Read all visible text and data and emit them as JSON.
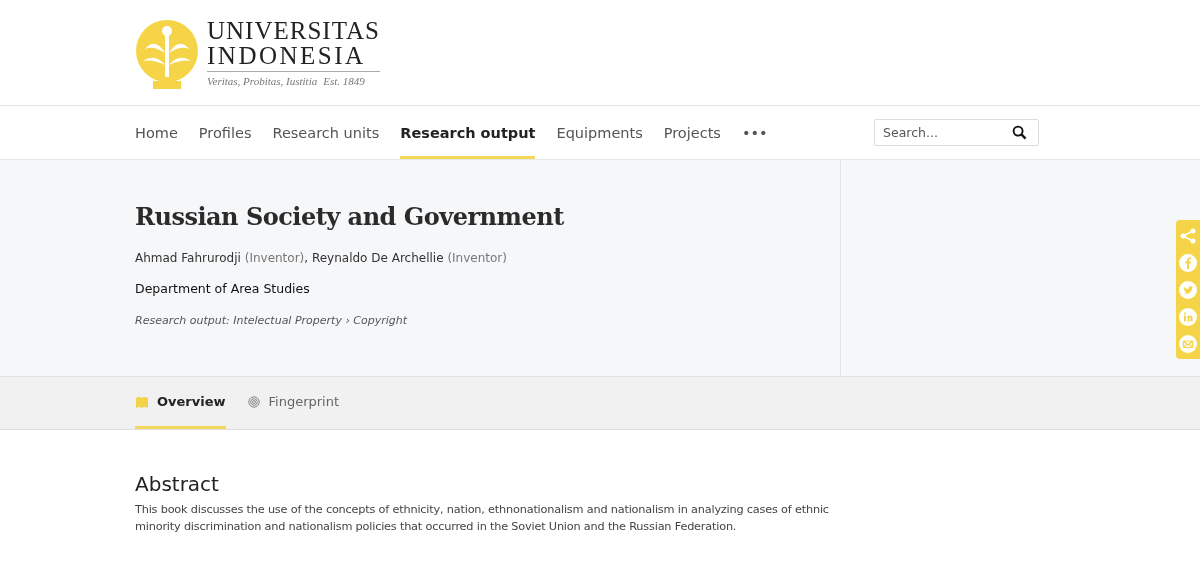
{
  "logo": {
    "name_line1": "UNIVERSITAS",
    "name_line2": "INDONESIA",
    "motto": "Veritas, Probitas, Iustitia",
    "established": "Est. 1849"
  },
  "nav": [
    {
      "label": "Home",
      "selected": false
    },
    {
      "label": "Profiles",
      "selected": false
    },
    {
      "label": "Research units",
      "selected": false
    },
    {
      "label": "Research output",
      "selected": true
    },
    {
      "label": "Equipments",
      "selected": false
    },
    {
      "label": "Projects",
      "selected": false
    },
    {
      "label": "•••",
      "selected": false
    }
  ],
  "search": {
    "placeholder": "Search..."
  },
  "title": "Russian Society and Government",
  "authors": [
    {
      "name": "Ahmad Fahrurodji",
      "role": "(Inventor)",
      "separator": ","
    },
    {
      "name": "Reynaldo De Archellie",
      "role": "(Inventor)"
    }
  ],
  "department": "Department of Area Studies",
  "type_line": "Research output: Intelectual Property › Copyright",
  "share": [
    {
      "kind": "share"
    },
    {
      "kind": "facebook"
    },
    {
      "kind": "twitter"
    },
    {
      "kind": "linkedin"
    },
    {
      "kind": "email"
    }
  ],
  "tabs": [
    {
      "label": "Overview",
      "kind": "book",
      "selected": true
    },
    {
      "label": "Fingerprint",
      "kind": "fingerprint",
      "selected": false
    }
  ],
  "abstract": {
    "heading": "Abstract",
    "text": "This book discusses the use of the concepts of ethnicity, nation, ethnonationalism and nationalism in analyzing cases of ethnic minority discrimination and nationalism policies that occurred in the Soviet Union and the Russian Federation."
  }
}
